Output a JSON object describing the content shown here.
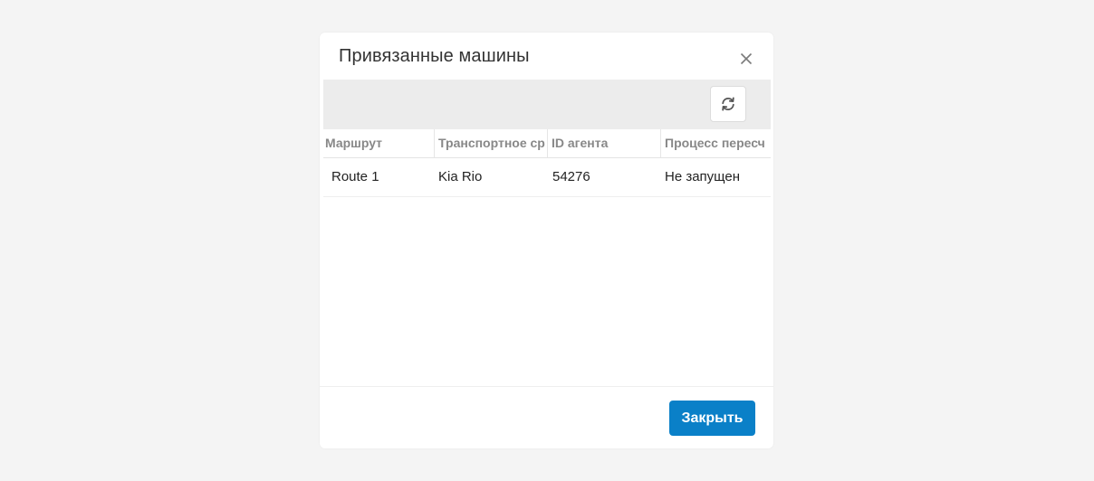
{
  "modal": {
    "title": "Привязанные машины",
    "close_icon": "close-icon"
  },
  "toolbar": {
    "refresh_icon": "refresh-icon"
  },
  "table": {
    "columns": [
      "Маршрут",
      "Транспортное ср",
      "ID агента",
      "Процесс пересч"
    ],
    "rows": [
      [
        "Route 1",
        "Kia Rio",
        "54276",
        "Не запущен"
      ]
    ]
  },
  "footer": {
    "close_label": "Закрыть"
  },
  "colors": {
    "accent": "#0a80c8",
    "background": "#f4f4f4",
    "toolbar": "#ececec"
  }
}
